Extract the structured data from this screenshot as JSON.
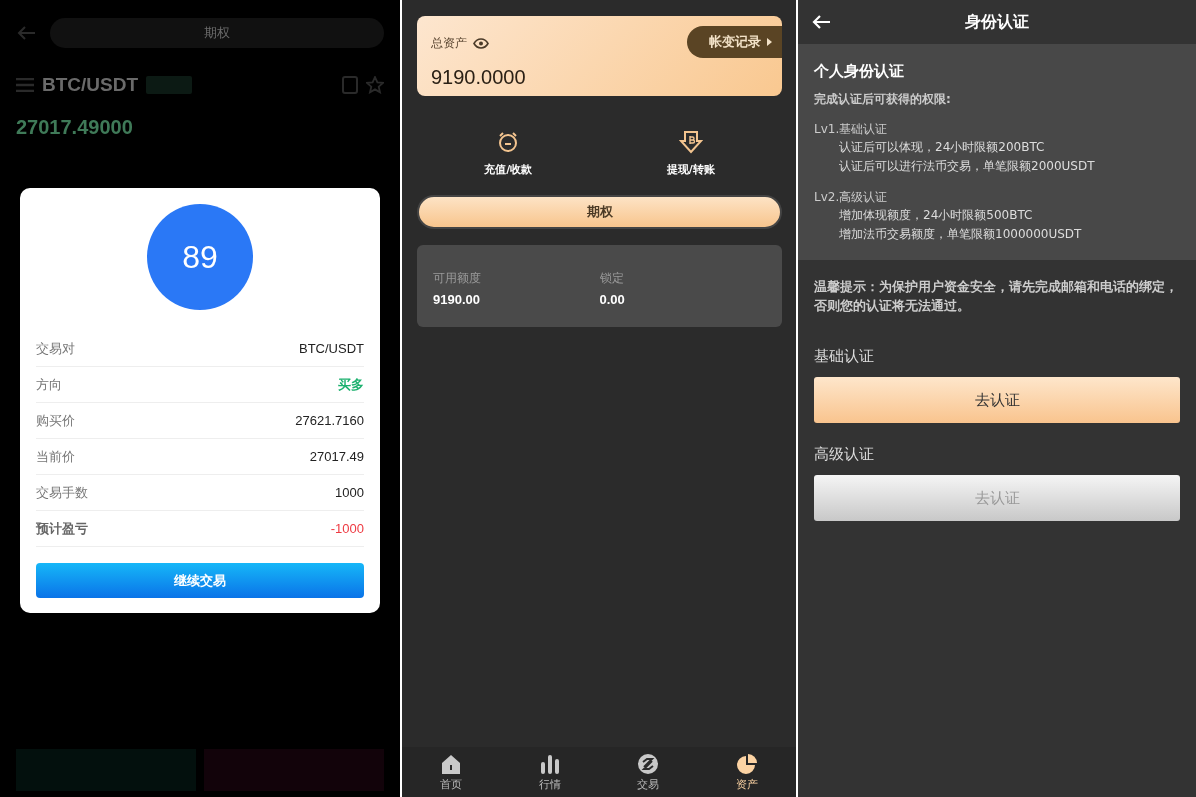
{
  "trade_screen": {
    "header_title": "期权",
    "pair": "BTC/USDT",
    "price": "27017.49000",
    "result_dialog": {
      "countdown": "89",
      "rows": [
        {
          "label": "交易对",
          "value": "BTC/USDT",
          "kind": "plain"
        },
        {
          "label": "方向",
          "value": "买多",
          "kind": "up"
        },
        {
          "label": "购买价",
          "value": "27621.7160",
          "kind": "plain"
        },
        {
          "label": "当前价",
          "value": "27017.49",
          "kind": "plain"
        },
        {
          "label": "交易手数",
          "value": "1000",
          "kind": "plain"
        },
        {
          "label": "预计盈亏",
          "value": "-1000",
          "kind": "loss"
        }
      ],
      "button": "继续交易"
    }
  },
  "assets_screen": {
    "total_label": "总资产",
    "records_button": "帐变记录",
    "total_value": "9190.0000",
    "actions": [
      {
        "label": "充值/收款",
        "kind": "deposit"
      },
      {
        "label": "提现/转账",
        "kind": "withdraw"
      }
    ],
    "category_tab": "期权",
    "balances": [
      {
        "label": "可用额度",
        "value": "9190.00"
      },
      {
        "label": "锁定",
        "value": "0.00"
      }
    ],
    "tab_bar": [
      {
        "label": "首页",
        "kind": "home",
        "selected": false
      },
      {
        "label": "行情",
        "kind": "market",
        "selected": false
      },
      {
        "label": "交易",
        "kind": "trade",
        "selected": false
      },
      {
        "label": "资产",
        "kind": "assets",
        "selected": true
      }
    ]
  },
  "verify_screen": {
    "title": "身份认证",
    "info": {
      "heading": "个人身份认证",
      "subheading": "完成认证后可获得的权限:",
      "levels": [
        {
          "name": "Lv1.基础认证",
          "lines": [
            "认证后可以体现，24小时限额200BTC",
            "认证后可以进行法币交易，单笔限额2000USDT"
          ]
        },
        {
          "name": "Lv2.高级认证",
          "lines": [
            "增加体现额度，24小时限额500BTC",
            "增加法币交易额度，单笔限额1000000USDT"
          ]
        }
      ]
    },
    "tip": "温馨提示：为保护用户资金安全，请先完成邮箱和电话的绑定，否则您的认证将无法通过。",
    "sections": [
      {
        "label": "基础认证",
        "button": "去认证",
        "disabled": false
      },
      {
        "label": "高级认证",
        "button": "去认证",
        "disabled": true
      }
    ]
  }
}
